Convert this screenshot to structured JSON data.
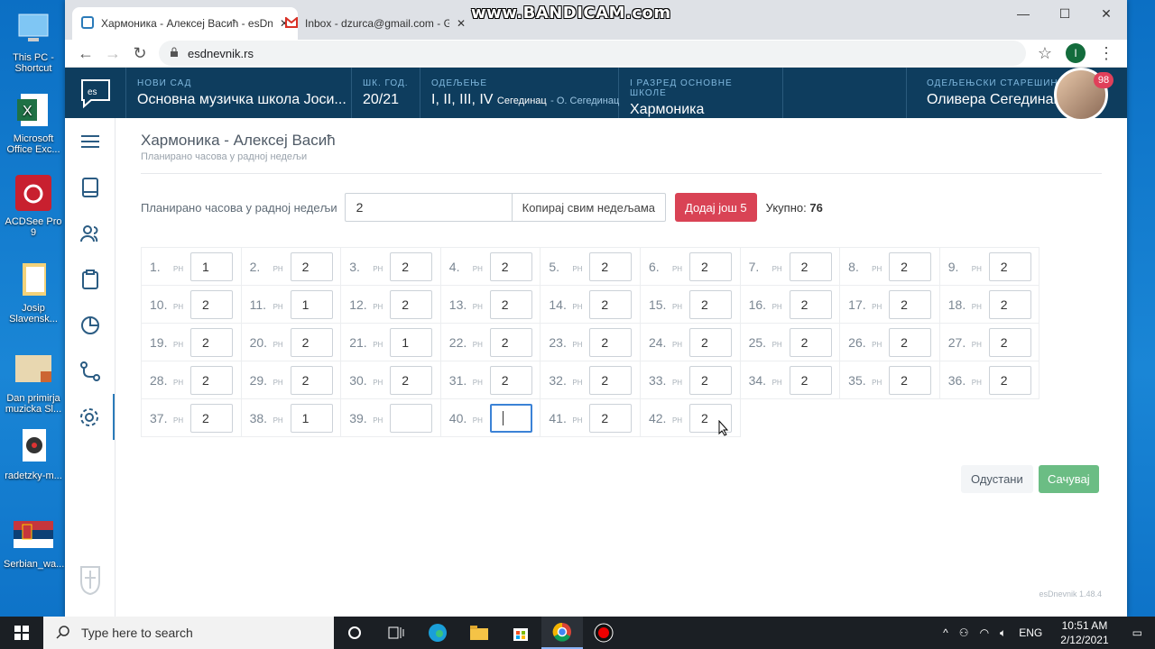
{
  "desktop": {
    "icons": [
      {
        "label": "This PC - Shortcut",
        "icon": "computer-icon"
      },
      {
        "label": "Microsoft Office Exc...",
        "icon": "excel-icon"
      },
      {
        "label": "ACDSee Pro 9",
        "icon": "acdsee-icon"
      },
      {
        "label": "Josip Slavensk...",
        "icon": "folder-icon"
      },
      {
        "label": "Dan primirja muzicka Sl...",
        "icon": "document-icon"
      },
      {
        "label": "radetzky-m...",
        "icon": "media-icon"
      },
      {
        "label": "Serbian_wa...",
        "icon": "flag-icon"
      }
    ]
  },
  "browser": {
    "tabs": [
      {
        "title": "Хармоника - Алексеј Васић - esDnevnik"
      },
      {
        "title": "Inbox - dzurca@gmail.com - Gmail"
      }
    ],
    "url": "esdnevnik.rs",
    "profile_initial": "I",
    "watermark": "www.BANDICAM.com"
  },
  "header": {
    "city_label": "НОВИ САД",
    "school": "Основна музичка школа Јоси...",
    "year_label": "ШК. ГОД.",
    "year": "20/21",
    "class_label": "ОДЕЉЕЊЕ",
    "class": "I, II, III, IV",
    "class_extra": "Сегединац",
    "class_muted": "- О. Сегединац",
    "grade_label": "I РАЗРЕД ОСНОВНЕ ШКОЛЕ",
    "subject": "Хармоника",
    "teacher_label": "ОДЕЉЕЊСКИ СТАРЕШИНА",
    "teacher": "Оливера Сегединац",
    "notifications": "98"
  },
  "page": {
    "title": "Хармоника - Алексеј Васић",
    "subtitle": "Планирано часова у радној недељи",
    "planned_label": "Планирано часова у радној недељи",
    "planned_value": "2",
    "copy_button": "Копирај свим недељама",
    "add_button": "Додај још 5",
    "total_label": "Укупно:",
    "total_value": "76",
    "week_suffix": "РН",
    "cancel_button": "Одустани",
    "save_button": "Сачувај",
    "version": "esDnevnik 1.48.4"
  },
  "weeks": [
    {
      "n": "1.",
      "v": "1"
    },
    {
      "n": "2.",
      "v": "2"
    },
    {
      "n": "3.",
      "v": "2"
    },
    {
      "n": "4.",
      "v": "2"
    },
    {
      "n": "5.",
      "v": "2"
    },
    {
      "n": "6.",
      "v": "2"
    },
    {
      "n": "7.",
      "v": "2"
    },
    {
      "n": "8.",
      "v": "2"
    },
    {
      "n": "9.",
      "v": "2"
    },
    {
      "n": "10.",
      "v": "2"
    },
    {
      "n": "11.",
      "v": "1"
    },
    {
      "n": "12.",
      "v": "2"
    },
    {
      "n": "13.",
      "v": "2"
    },
    {
      "n": "14.",
      "v": "2"
    },
    {
      "n": "15.",
      "v": "2"
    },
    {
      "n": "16.",
      "v": "2"
    },
    {
      "n": "17.",
      "v": "2"
    },
    {
      "n": "18.",
      "v": "2"
    },
    {
      "n": "19.",
      "v": "2"
    },
    {
      "n": "20.",
      "v": "2"
    },
    {
      "n": "21.",
      "v": "1"
    },
    {
      "n": "22.",
      "v": "2"
    },
    {
      "n": "23.",
      "v": "2"
    },
    {
      "n": "24.",
      "v": "2"
    },
    {
      "n": "25.",
      "v": "2"
    },
    {
      "n": "26.",
      "v": "2"
    },
    {
      "n": "27.",
      "v": "2"
    },
    {
      "n": "28.",
      "v": "2"
    },
    {
      "n": "29.",
      "v": "2"
    },
    {
      "n": "30.",
      "v": "2"
    },
    {
      "n": "31.",
      "v": "2"
    },
    {
      "n": "32.",
      "v": "2"
    },
    {
      "n": "33.",
      "v": "2"
    },
    {
      "n": "34.",
      "v": "2"
    },
    {
      "n": "35.",
      "v": "2"
    },
    {
      "n": "36.",
      "v": "2"
    },
    {
      "n": "37.",
      "v": "2"
    },
    {
      "n": "38.",
      "v": "1"
    },
    {
      "n": "39.",
      "v": ""
    },
    {
      "n": "40.",
      "v": "",
      "focused": true
    },
    {
      "n": "41.",
      "v": "2"
    },
    {
      "n": "42.",
      "v": "2"
    }
  ],
  "taskbar": {
    "search_placeholder": "Type here to search",
    "language": "ENG",
    "time": "10:51 AM",
    "date": "2/12/2021"
  }
}
